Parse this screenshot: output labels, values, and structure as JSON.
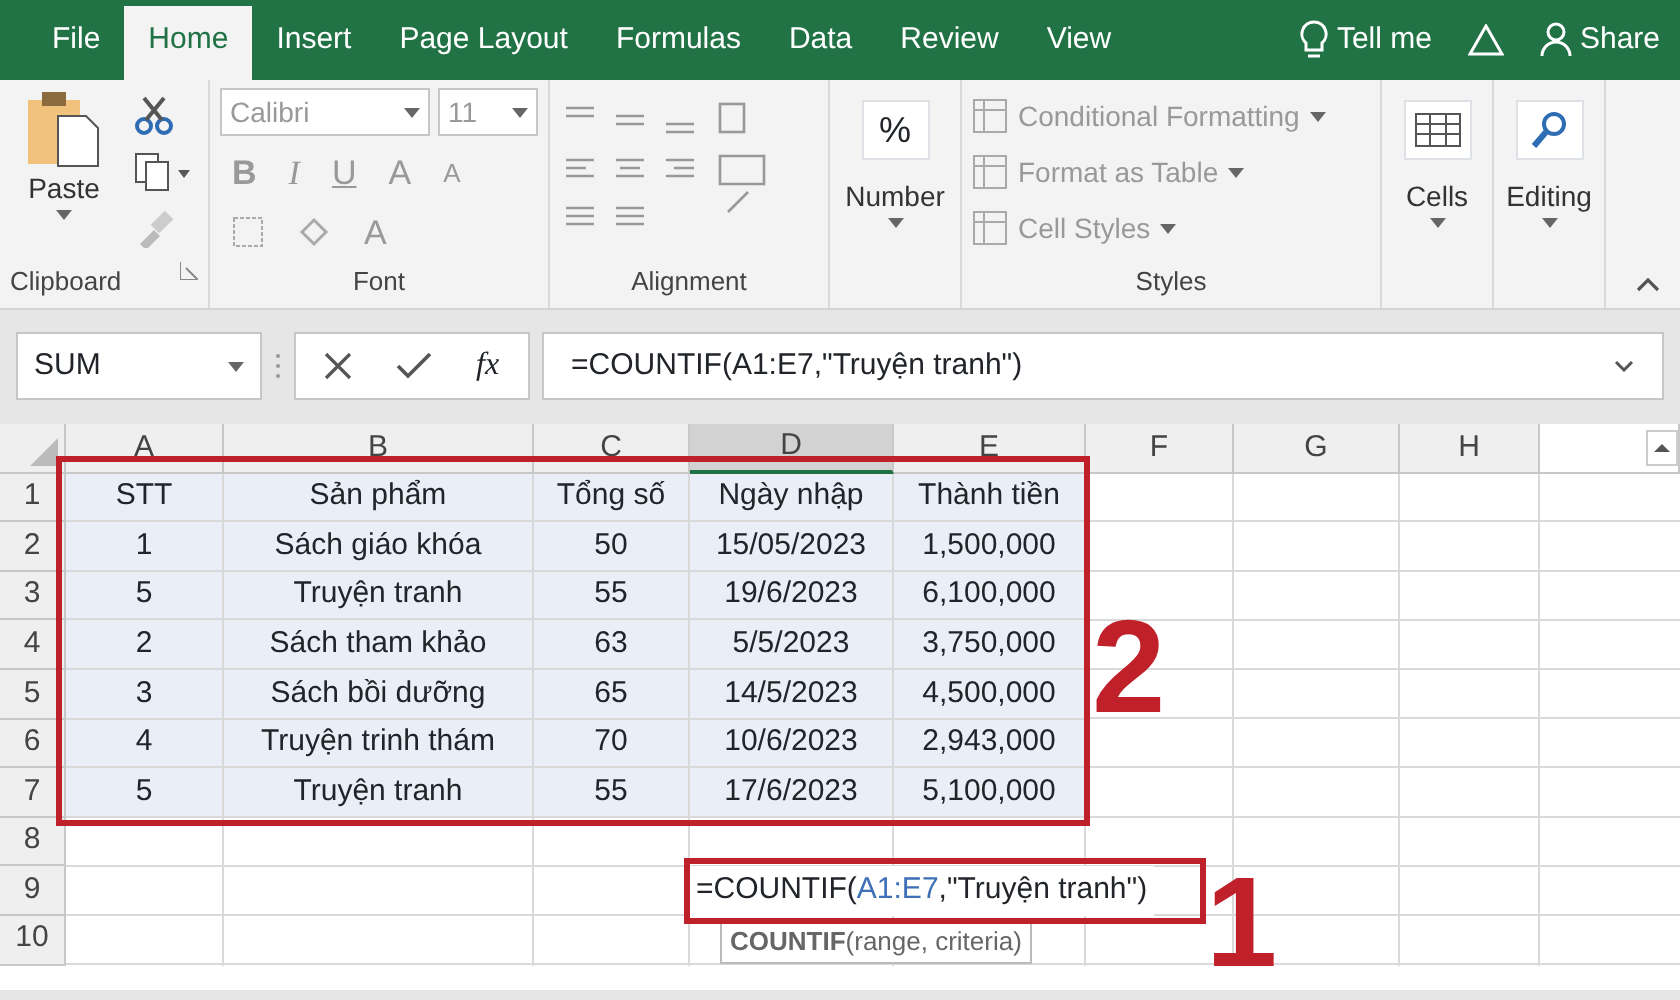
{
  "ribbon_tabs": [
    {
      "label": "File",
      "selected": false
    },
    {
      "label": "Home",
      "selected": true
    },
    {
      "label": "Insert",
      "selected": false
    },
    {
      "label": "Page Layout",
      "selected": false
    },
    {
      "label": "Formulas",
      "selected": false
    },
    {
      "label": "Data",
      "selected": false
    },
    {
      "label": "Review",
      "selected": false
    },
    {
      "label": "View",
      "selected": false
    }
  ],
  "tell_me": {
    "label": "Tell me"
  },
  "share": {
    "label": "Share"
  },
  "clipboard": {
    "paste": "Paste",
    "group_label": "Clipboard"
  },
  "font": {
    "font_name": "Calibri",
    "font_size": "11",
    "bold": "B",
    "italic": "I",
    "underline": "U",
    "grow": "A",
    "shrink": "A",
    "font_color": "A",
    "group_label": "Font"
  },
  "alignment": {
    "group_label": "Alignment"
  },
  "number": {
    "symbol": "%",
    "label": "Number"
  },
  "styles": {
    "items": [
      "Conditional Formatting",
      "Format as Table",
      "Cell Styles"
    ],
    "group_label": "Styles"
  },
  "cells": {
    "label": "Cells"
  },
  "editing": {
    "label": "Editing"
  },
  "formula_bar": {
    "name_box": "SUM",
    "fx": "fx",
    "formula": "=COUNTIF(A1:E7,\"Truyện tranh\")"
  },
  "sheet": {
    "columns": [
      {
        "label": "A",
        "selected": false
      },
      {
        "label": "B",
        "selected": false
      },
      {
        "label": "C",
        "selected": false
      },
      {
        "label": "D",
        "selected": true
      },
      {
        "label": "E",
        "selected": false
      },
      {
        "label": "F",
        "selected": false
      },
      {
        "label": "G",
        "selected": false
      },
      {
        "label": "H",
        "selected": false
      }
    ],
    "rows": [
      {
        "label": "1",
        "cells": [
          "STT",
          "Sản phẩm",
          "Tổng số",
          "Ngày nhập",
          "Thành tiền"
        ]
      },
      {
        "label": "2",
        "cells": [
          "1",
          "Sách giáo khóa",
          "50",
          "15/05/2023",
          "1,500,000"
        ]
      },
      {
        "label": "3",
        "cells": [
          "5",
          "Truyện tranh",
          "55",
          "19/6/2023",
          "6,100,000"
        ]
      },
      {
        "label": "4",
        "cells": [
          "2",
          "Sách tham khảo",
          "63",
          "5/5/2023",
          "3,750,000"
        ]
      },
      {
        "label": "5",
        "cells": [
          "3",
          "Sách bồi dưỡng",
          "65",
          "14/5/2023",
          "4,500,000"
        ]
      },
      {
        "label": "6",
        "cells": [
          "4",
          "Truyện trinh thám",
          "70",
          "10/6/2023",
          "2,943,000"
        ]
      },
      {
        "label": "7",
        "cells": [
          "5",
          "Truyện tranh",
          "55",
          "17/6/2023",
          "5,100,000"
        ]
      },
      {
        "label": "8",
        "cells": []
      },
      {
        "label": "9",
        "cells": []
      },
      {
        "label": "10",
        "cells": []
      }
    ],
    "editing_cell": {
      "parts": [
        {
          "text": "=COUNTIF(",
          "kind": "plain"
        },
        {
          "text": "A1:E7",
          "kind": "reference"
        },
        {
          "text": ",\"Truyện tranh\")",
          "kind": "plain"
        }
      ]
    },
    "tooltip": "**COUNTIF**(range, criteria)"
  },
  "annotations": [
    {
      "label": "2",
      "kind": "range"
    },
    {
      "label": "1",
      "kind": "cell"
    }
  ]
}
